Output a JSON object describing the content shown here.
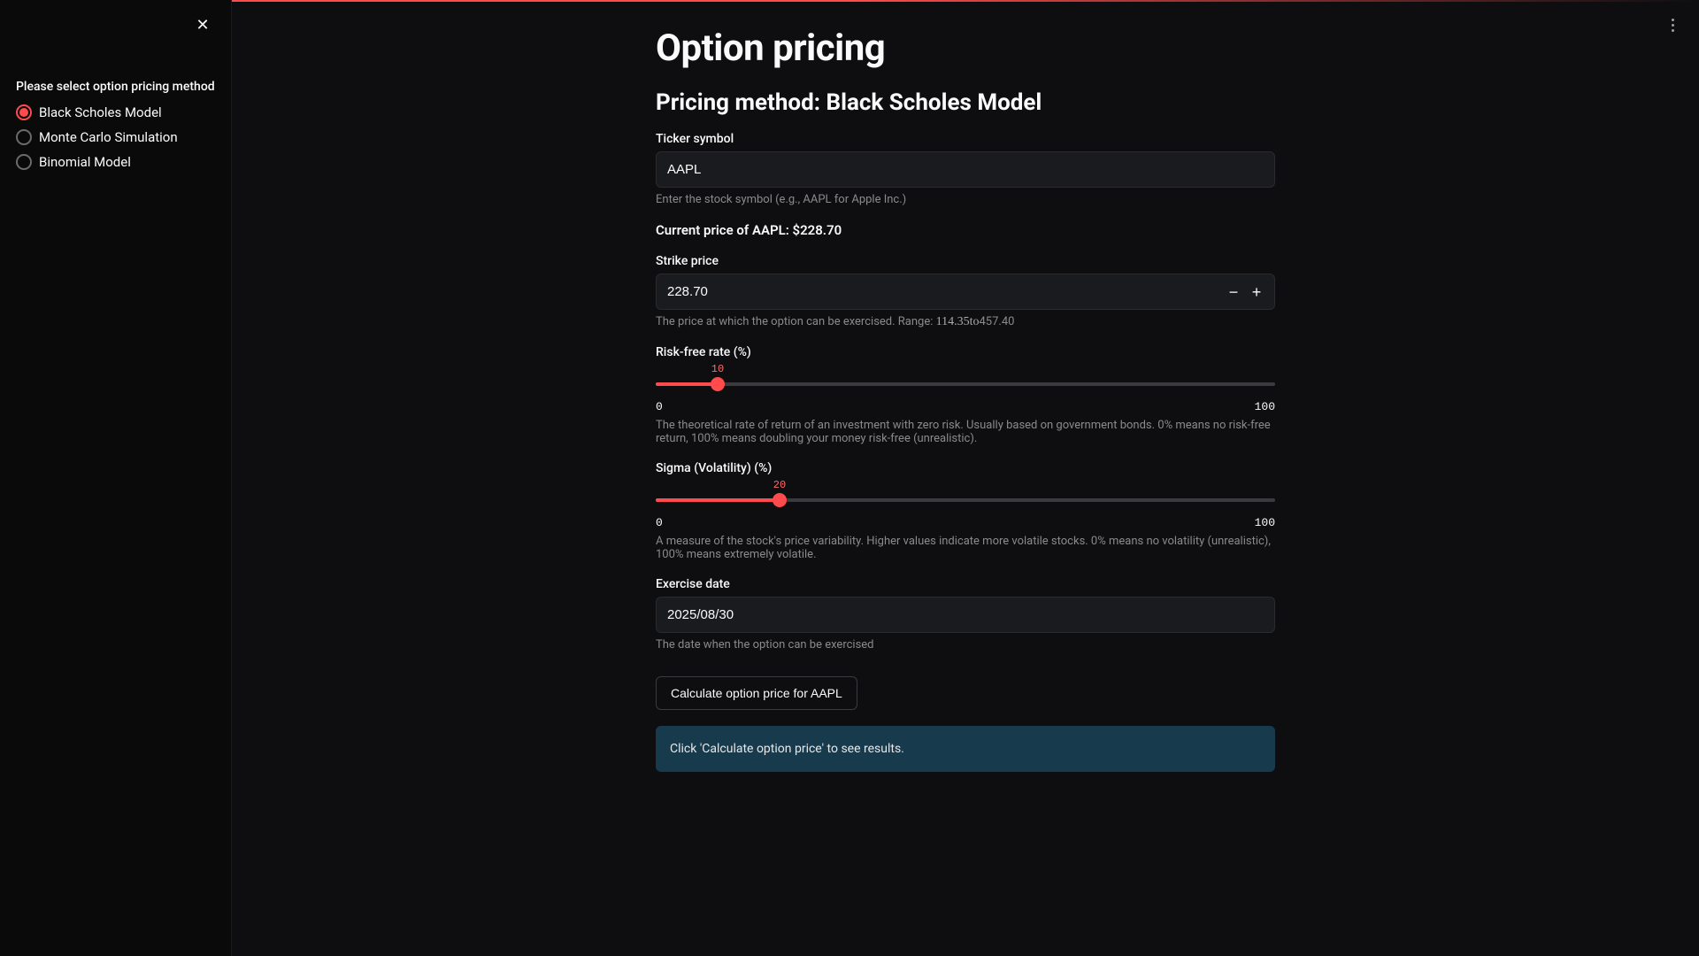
{
  "sidebar": {
    "label": "Please select option pricing method",
    "options": [
      "Black Scholes Model",
      "Monte Carlo Simulation",
      "Binomial Model"
    ],
    "selected_index": 0
  },
  "page": {
    "title": "Option pricing",
    "subtitle": "Pricing method: Black Scholes Model"
  },
  "ticker": {
    "label": "Ticker symbol",
    "value": "AAPL",
    "help": "Enter the stock symbol (e.g., AAPL for Apple Inc.)"
  },
  "current_price": {
    "text": "Current price of AAPL: $228.70"
  },
  "strike": {
    "label": "Strike price",
    "value": "228.70",
    "help_prefix": "The price at which the option can be exercised. Range: ",
    "range_low": "114.35",
    "range_mid": "to",
    "range_high": "457.40"
  },
  "risk_free": {
    "label": "Risk-free rate (%)",
    "value": 10,
    "min": "0",
    "max": "100",
    "help": "The theoretical rate of return of an investment with zero risk. Usually based on government bonds. 0% means no risk-free return, 100% means doubling your money risk-free (unrealistic)."
  },
  "sigma": {
    "label": "Sigma (Volatility) (%)",
    "value": 20,
    "min": "0",
    "max": "100",
    "help": "A measure of the stock's price variability. Higher values indicate more volatile stocks. 0% means no volatility (unrealistic), 100% means extremely volatile."
  },
  "exercise_date": {
    "label": "Exercise date",
    "value": "2025/08/30",
    "help": "The date when the option can be exercised"
  },
  "calculate_button": "Calculate option price for AAPL",
  "info_box": "Click 'Calculate option price' to see results."
}
